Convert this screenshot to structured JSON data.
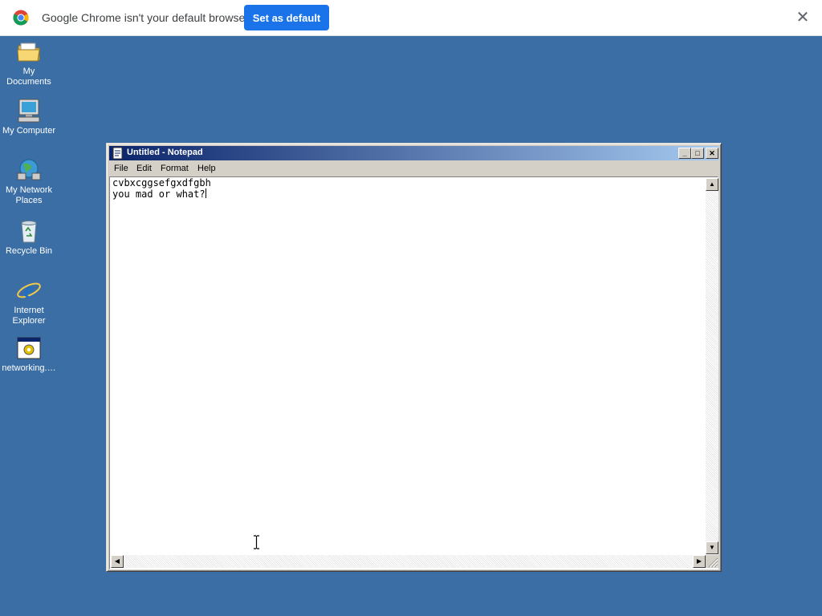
{
  "infobar": {
    "message": "Google Chrome isn't your default browser",
    "button_label": "Set as default",
    "close_glyph": "✕",
    "icons": {
      "logo": "chrome-logo-icon",
      "close": "close-icon"
    }
  },
  "desktop": {
    "icons": [
      {
        "label": "My Documents",
        "icon": "folder-icon"
      },
      {
        "label": "My Computer",
        "icon": "computer-icon"
      },
      {
        "label": "My Network Places",
        "icon": "network-icon"
      },
      {
        "label": "Recycle Bin",
        "icon": "recycle-bin-icon"
      },
      {
        "label": "Internet Explorer",
        "icon": "internet-explorer-icon"
      },
      {
        "label": "networking.…",
        "icon": "program-icon"
      }
    ]
  },
  "notepad": {
    "title": "Untitled - Notepad",
    "menu": [
      "File",
      "Edit",
      "Format",
      "Help"
    ],
    "title_buttons": [
      "_",
      "□",
      "✕"
    ],
    "content_lines": [
      "cvbxcggsefgxdfgbh",
      "you mad or what?"
    ],
    "scroll_glyphs": {
      "up": "▲",
      "down": "▼",
      "left": "◀",
      "right": "▶"
    }
  },
  "colors": {
    "desktop": "#3a6ea5",
    "titlebar_start": "#0a246a",
    "titlebar_end": "#a6caf0",
    "chrome_button": "#1a73e8",
    "window_face": "#d4d0c8"
  }
}
